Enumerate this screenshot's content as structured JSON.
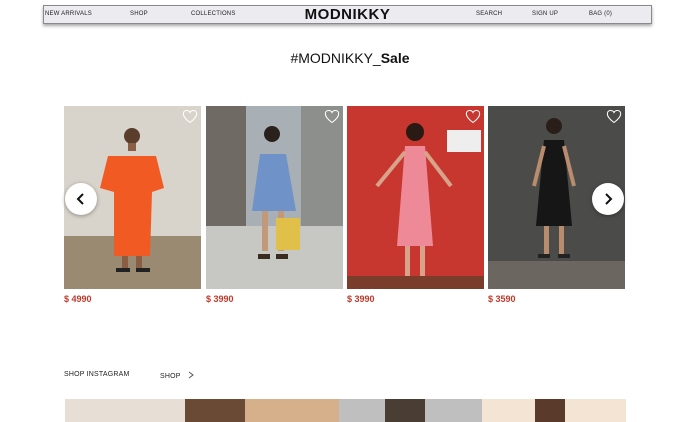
{
  "nav": {
    "new_arrivals": "NEW ARRIVALS",
    "shop": "SHOP",
    "collections": "COLLECTIONS",
    "brand": "MODNIKKY",
    "search": "SEARCH",
    "sign_up": "SIGN UP",
    "bag": "BAG (0)"
  },
  "sale": {
    "prefix": "#MODNIKKY_",
    "emphasis": "Sale"
  },
  "products": [
    {
      "price": "$ 4990",
      "dress": "orange kaftan dress",
      "colors": {
        "bg": "#c9c3b8",
        "dress": "#f15a22"
      }
    },
    {
      "price": "$ 3990",
      "dress": "blue floral slip dress",
      "colors": {
        "bg": "#9aa4ae",
        "dress": "#6f93c9"
      }
    },
    {
      "price": "$ 3990",
      "dress": "pink midi dress",
      "colors": {
        "bg": "#c83a33",
        "dress": "#ee8a97"
      }
    },
    {
      "price": "$ 3590",
      "dress": "black slip dress",
      "colors": {
        "bg": "#4a4a48",
        "dress": "#161616"
      }
    }
  ],
  "carousel": {
    "prev_icon": "chevron-left-icon",
    "next_icon": "chevron-right-icon",
    "favorite_icon": "heart-outline-icon"
  },
  "instagram": {
    "label": "SHOP INSTAGRAM",
    "shop_link": "SHOP",
    "shop_icon": "chevron-right-icon"
  },
  "colors": {
    "price": "#c0392b",
    "nav_bg": "#ecebf0"
  }
}
